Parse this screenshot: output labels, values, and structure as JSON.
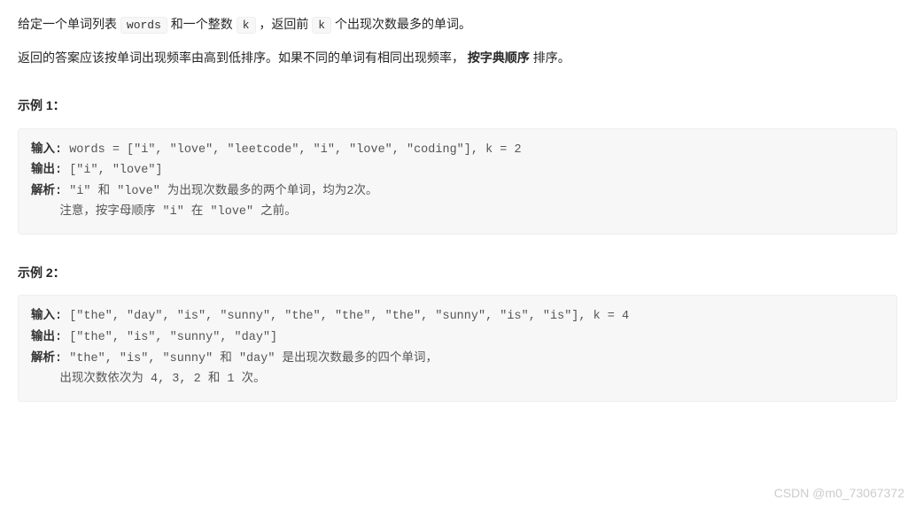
{
  "description": {
    "line1_pre": "给定一个单词列表 ",
    "line1_code1": "words",
    "line1_mid": " 和一个整数 ",
    "line1_code2": "k",
    "line1_mid2": " ，返回前 ",
    "line1_code3": "k",
    "line1_post": " 个出现次数最多的单词。",
    "line2_pre": "返回的答案应该按单词出现频率由高到低排序。如果不同的单词有相同出现频率， ",
    "line2_bold": "按字典顺序",
    "line2_post": " 排序。"
  },
  "example1": {
    "title": "示例 1：",
    "input_label": "输入:",
    "input_value": " words = [\"i\", \"love\", \"leetcode\", \"i\", \"love\", \"coding\"], k = 2",
    "output_label": "输出:",
    "output_value": " [\"i\", \"love\"]",
    "explain_label": "解析:",
    "explain_value": " \"i\" 和 \"love\" 为出现次数最多的两个单词，均为2次。",
    "explain_cont": "    注意，按字母顺序 \"i\" 在 \"love\" 之前。"
  },
  "example2": {
    "title": "示例 2：",
    "input_label": "输入:",
    "input_value": " [\"the\", \"day\", \"is\", \"sunny\", \"the\", \"the\", \"the\", \"sunny\", \"is\", \"is\"], k = 4",
    "output_label": "输出:",
    "output_value": " [\"the\", \"is\", \"sunny\", \"day\"]",
    "explain_label": "解析:",
    "explain_value": " \"the\", \"is\", \"sunny\" 和 \"day\" 是出现次数最多的四个单词，",
    "explain_cont": "    出现次数依次为 4, 3, 2 和 1 次。"
  },
  "watermark": "CSDN @m0_73067372"
}
